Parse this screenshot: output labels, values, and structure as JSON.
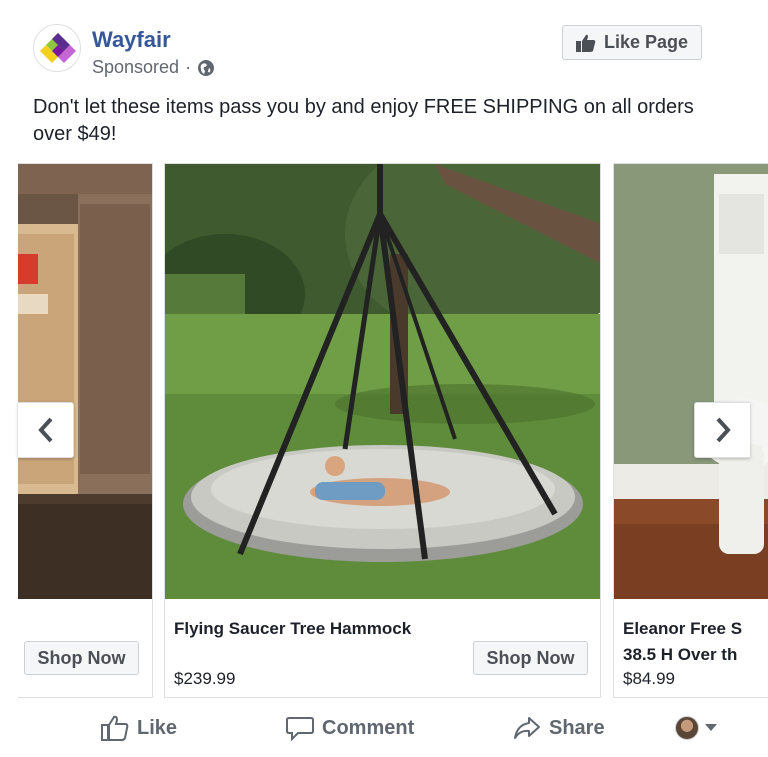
{
  "post": {
    "page_name": "Wayfair",
    "sponsored_label": "Sponsored",
    "separator": "·",
    "like_page_label": "Like Page",
    "text": "Don't let these items pass you by and enjoy FREE SHIPPING on all orders over $49!",
    "brand_colors": {
      "link": "#365899",
      "logo_purple": "#7b189f",
      "logo_green": "#8dc63f",
      "logo_yellow": "#f4d11c"
    }
  },
  "carousel": {
    "cards": [
      {
        "title": "",
        "price": "",
        "button_label": "Shop Now",
        "image": "kitchen-cabinet-photo"
      },
      {
        "title": "Flying Saucer Tree Hammock",
        "price": "$239.99",
        "button_label": "Shop Now",
        "image": "saucer-hammock-photo"
      },
      {
        "title": "Eleanor Free S",
        "title_line2": "38.5 H Over th",
        "price": "$84.99",
        "button_label": "",
        "image": "bathroom-cabinet-photo"
      }
    ],
    "prev_icon": "chevron-left-icon",
    "next_icon": "chevron-right-icon"
  },
  "actions": {
    "like_label": "Like",
    "comment_label": "Comment",
    "share_label": "Share"
  }
}
